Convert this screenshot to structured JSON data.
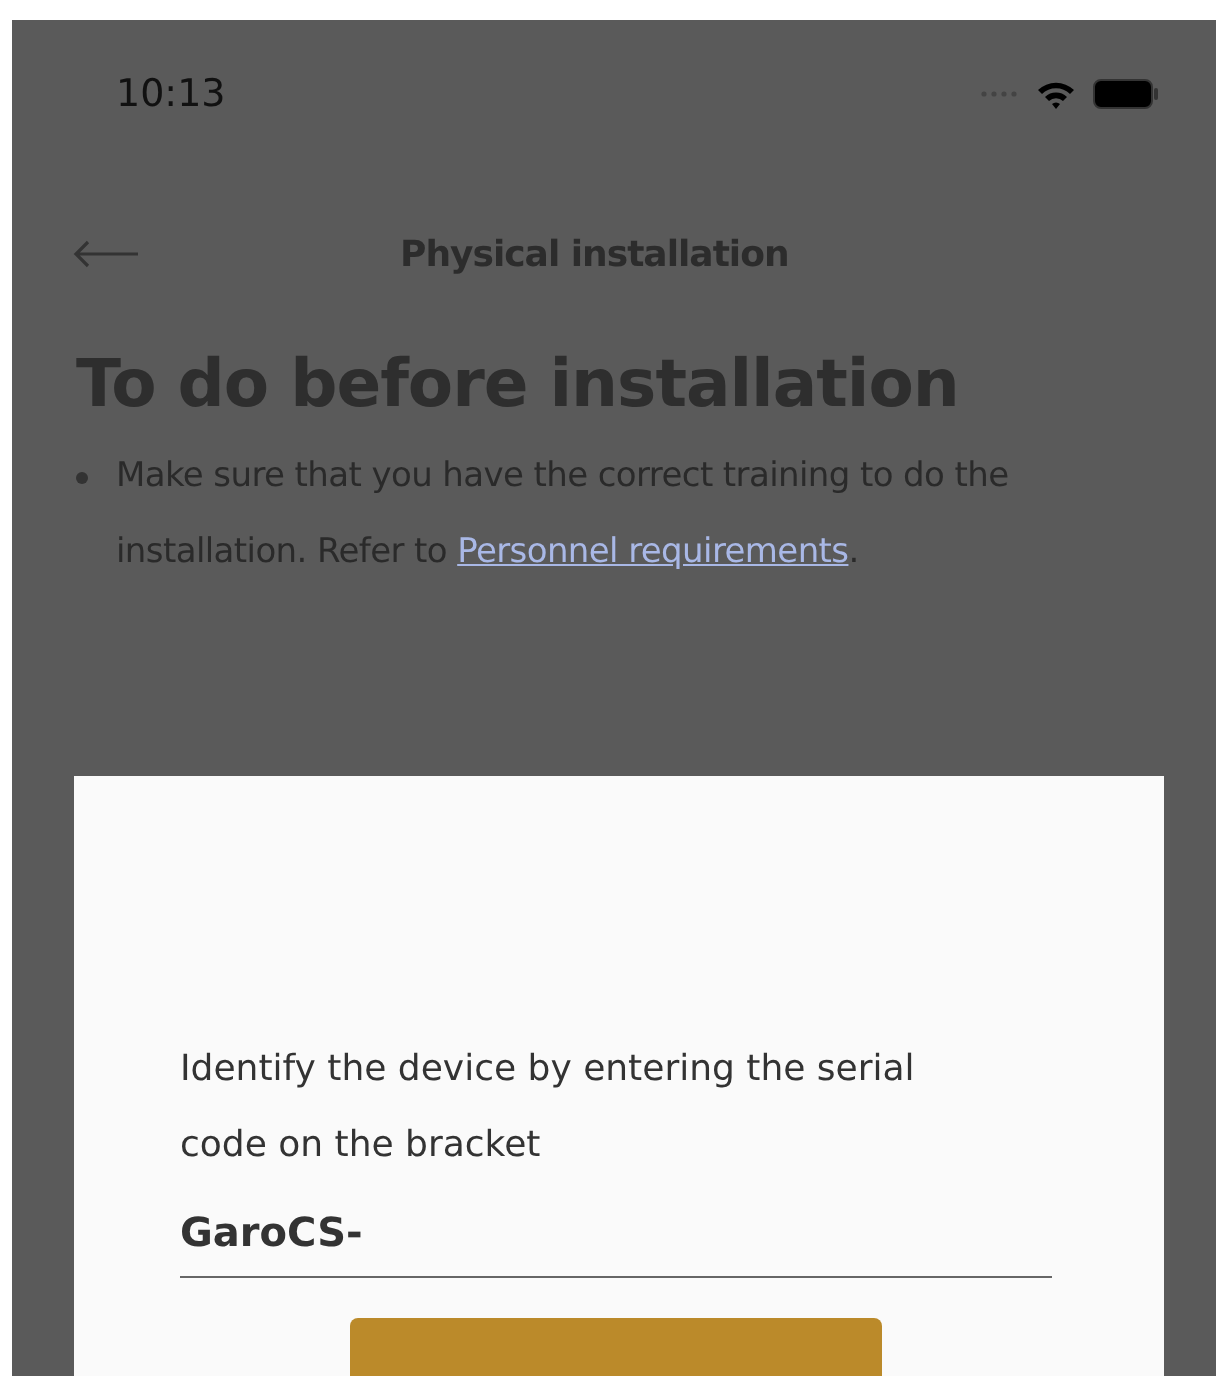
{
  "status_bar": {
    "time": "10:13"
  },
  "nav": {
    "title": "Physical installation"
  },
  "content": {
    "heading": "To do before installation",
    "bullets": [
      {
        "text": "Make sure that you have the correct training to do the installation. Refer to ",
        "link": "Personnel requirements",
        "after": "."
      }
    ]
  },
  "dialog": {
    "prompt": "Identify the device by entering the serial code on the bracket",
    "field": {
      "value": "GaroCS-"
    }
  }
}
